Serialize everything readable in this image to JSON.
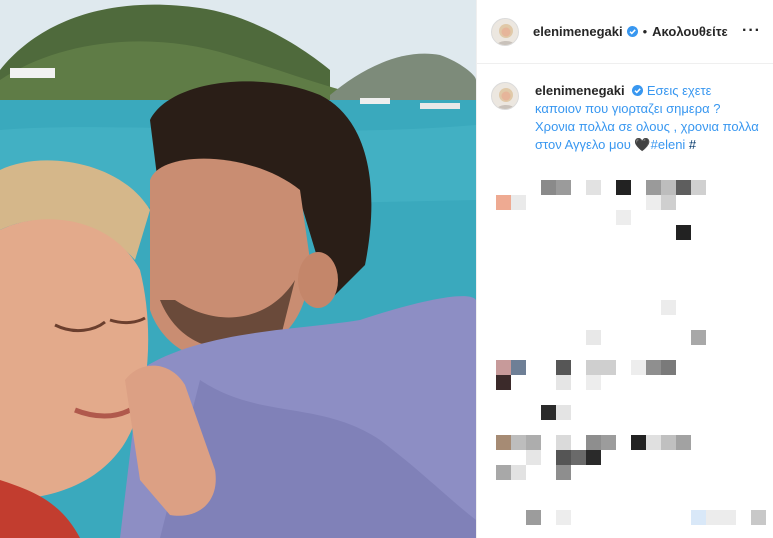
{
  "header": {
    "username": "elenimenegaki",
    "separator": "•",
    "follow_label": "Ακολουθείτε",
    "more_label": "···",
    "verified_icon": "verified-badge-icon"
  },
  "caption": {
    "username": "elenimenegaki",
    "text": "Εσεις εχετε καποιον που γιορταζει σημερα ? Χρονια πολλα σε ολους , χρονια πολλα στον Αγγελο μου ",
    "heart": "🖤",
    "hashtag": "#eleni",
    "trailing": " #"
  },
  "colors": {
    "link_blue": "#3897f0",
    "verified_blue": "#3897f0",
    "sea": "#3fb0c0",
    "sky": "#e6eef2",
    "shirt": "#8c8cbf"
  }
}
